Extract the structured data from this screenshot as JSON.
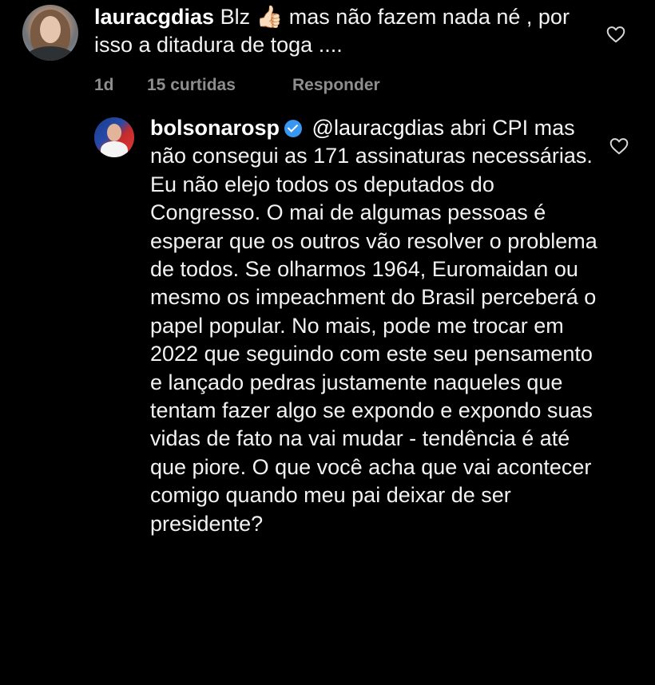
{
  "comments": [
    {
      "username": "lauracgdias",
      "text": "Blz 👍🏻 mas não fazem nada né , por isso a ditadura de toga ....",
      "time": "1d",
      "likes": "15 curtidas",
      "reply_label": "Responder",
      "avatar_icon": "profile-photo"
    },
    {
      "username": "bolsonarosp",
      "verified": true,
      "mention": "@lauracgdias",
      "text": "abri CPI mas não consegui as 171 assinaturas necessárias. Eu não elejo todos os deputados do Congresso. O mai de algumas pessoas é esperar que os outros vão resolver o problema de todos. Se olharmos 1964, Euromaidan ou mesmo os impeachment do Brasil perceberá o papel popular. No mais, pode me trocar em 2022 que seguindo com este seu pensamento e lançado pedras justamente naqueles que tentam fazer algo se expondo e expondo suas vidas de fato na vai mudar - tendência é até que piore. O que você acha que vai acontecer comigo quando meu pai deixar de ser presidente?",
      "avatar_icon": "profile-photo"
    }
  ],
  "icons": {
    "like": "heart-outline-icon",
    "verified": "verified-badge-icon"
  },
  "colors": {
    "background": "#000000",
    "text": "#f2f2f2",
    "meta": "#8e8e8e",
    "verified": "#3897f0"
  }
}
